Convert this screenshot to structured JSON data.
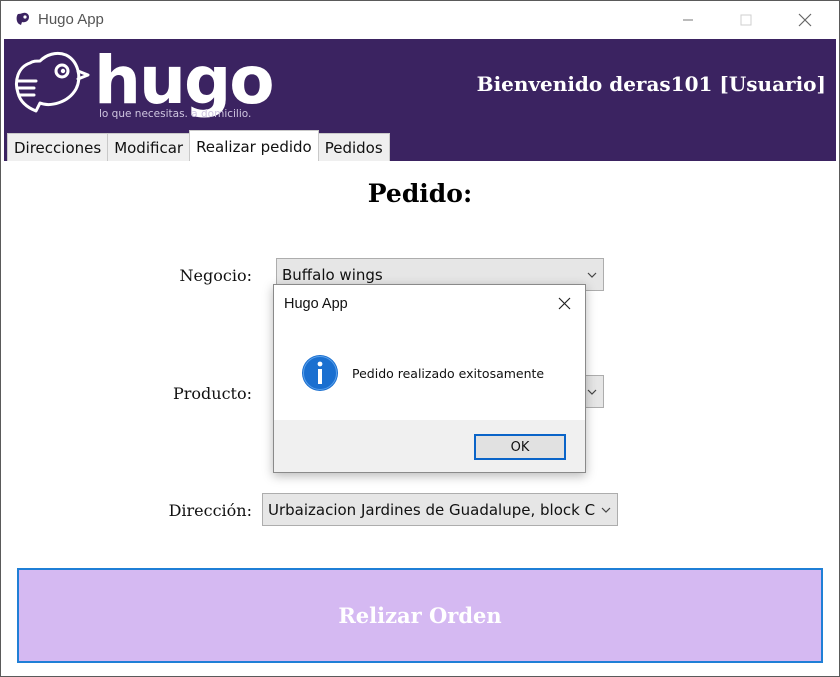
{
  "window": {
    "title": "Hugo App",
    "minimize_glyph": "—",
    "maximize_glyph": "☐",
    "close_glyph": "✕"
  },
  "header": {
    "logo_text": "hugo",
    "tagline": "lo que necesitas. a domicilio.",
    "welcome": "Bienvenido deras101 [Usuario]",
    "background_color": "#3b2361"
  },
  "tabs": [
    {
      "label": "Direcciones",
      "active": false
    },
    {
      "label": "Modificar",
      "active": false
    },
    {
      "label": "Realizar pedido",
      "active": true
    },
    {
      "label": "Pedidos",
      "active": false
    }
  ],
  "form": {
    "heading": "Pedido:",
    "negocio_label": "Negocio:",
    "negocio_value": "Buffalo wings",
    "producto_label": "Producto:",
    "producto_value": "",
    "direccion_label": "Dirección:",
    "direccion_value": "Urbaizacion Jardines de Guadalupe, block C",
    "order_button": "Relizar Orden",
    "order_button_color": "#d5b9f2"
  },
  "dialog": {
    "title": "Hugo App",
    "message": "Pedido realizado exitosamente",
    "ok_label": "OK",
    "icon": "info-icon"
  }
}
